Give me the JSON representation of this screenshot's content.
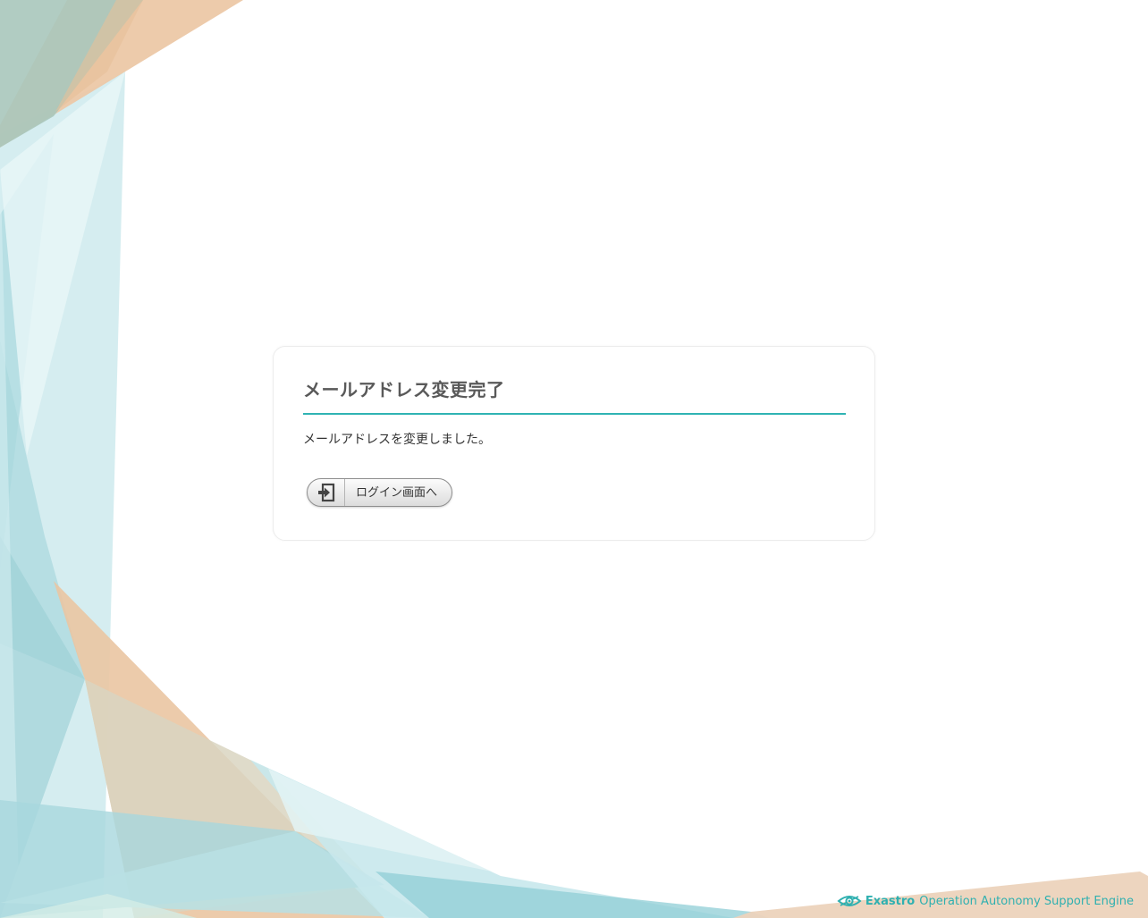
{
  "panel": {
    "title": "メールアドレス変更完了",
    "message": "メールアドレスを変更しました。",
    "button_label": "ログイン画面へ",
    "button_icon": "login-arrow-icon"
  },
  "footer": {
    "brand_name": "Exastro",
    "tagline": "Operation Autonomy Support Engine",
    "logo_icon": "exastro-eye-logo"
  },
  "colors": {
    "accent": "#2fb3b3",
    "background_teal": "#a9d9df",
    "background_peach": "#eac5a2"
  }
}
